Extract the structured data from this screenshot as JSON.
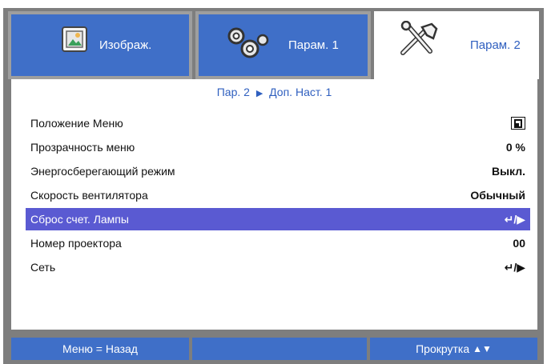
{
  "tabs": [
    {
      "label": "Изображ.",
      "icon": "image-icon"
    },
    {
      "label": "Парам. 1",
      "icon": "gears-icon"
    },
    {
      "label": "Парам. 2",
      "icon": "tools-icon"
    }
  ],
  "breadcrumb": {
    "left": "Пар. 2",
    "separator": "▶",
    "right": "Доп. Наст. 1"
  },
  "rows": [
    {
      "label": "Положение Меню",
      "value": "",
      "value_icon": "menu-position-icon"
    },
    {
      "label": "Прозрачность меню",
      "value": "0 %"
    },
    {
      "label": "Энергосберегающий режим",
      "value": "Выкл."
    },
    {
      "label": "Скорость вентилятора",
      "value": "Обычный"
    },
    {
      "label": "Сброс счет. Лампы",
      "value": "↵/▶",
      "selected": true
    },
    {
      "label": "Номер проектора",
      "value": "00"
    },
    {
      "label": "Сеть",
      "value": "↵/▶"
    }
  ],
  "footer": {
    "back": "Меню = Назад",
    "scroll": "Прокрутка",
    "scroll_arrows": "▲▼"
  },
  "colors": {
    "accent_blue": "#3f6fc8",
    "selection": "#5a5ad2",
    "frame_gray": "#7e7e7e",
    "text_blue": "#2f5fbf"
  }
}
